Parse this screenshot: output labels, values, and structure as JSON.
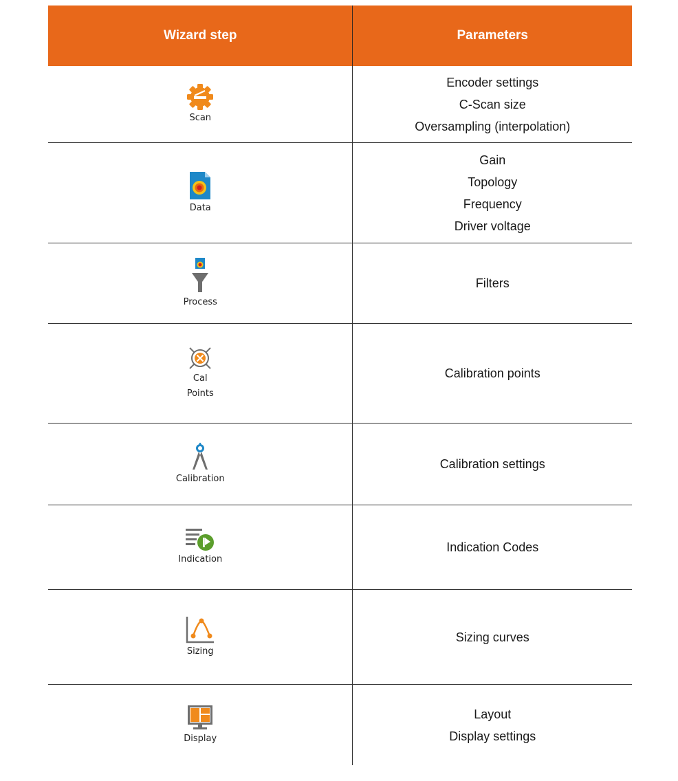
{
  "table": {
    "headers": [
      "Wizard step",
      "Parameters"
    ],
    "rows": [
      {
        "step": "Scan",
        "icon": "gear-scan-icon",
        "params": [
          "Encoder settings",
          "C-Scan size",
          "Oversampling (interpolation)"
        ]
      },
      {
        "step": "Data",
        "icon": "data-file-icon",
        "params": [
          "Gain",
          "Topology",
          "Frequency",
          "Driver voltage"
        ]
      },
      {
        "step": "Process",
        "icon": "funnel-filter-icon",
        "params": [
          "Filters"
        ]
      },
      {
        "step": "Cal",
        "step2": "Points",
        "icon": "calibration-target-icon",
        "params": [
          "Calibration points"
        ]
      },
      {
        "step": "Calibration",
        "icon": "compass-icon",
        "params": [
          "Calibration settings"
        ]
      },
      {
        "step": "Indication",
        "icon": "indication-list-icon",
        "params": [
          "Indication Codes"
        ]
      },
      {
        "step": "Sizing",
        "icon": "sizing-curve-icon",
        "params": [
          "Sizing curves"
        ]
      },
      {
        "step": "Display",
        "icon": "monitor-layout-icon",
        "params": [
          "Layout",
          "Display settings"
        ]
      }
    ]
  },
  "colors": {
    "header_bg": "#e8681a",
    "icon_orange": "#f08a1c",
    "icon_green": "#5b9e2c",
    "icon_blue": "#1e88c8",
    "icon_gray": "#6e6e6e"
  }
}
